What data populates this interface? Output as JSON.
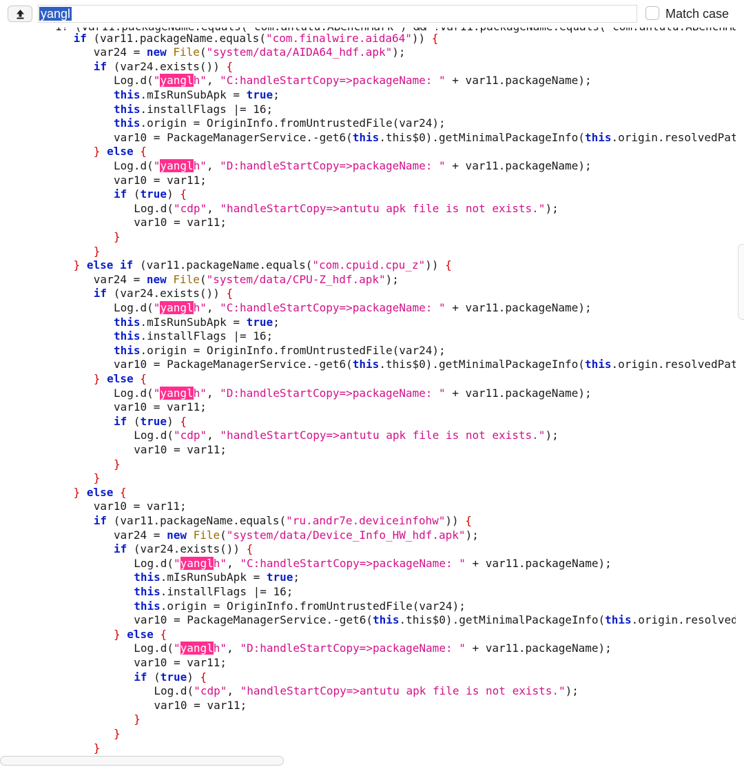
{
  "search": {
    "query": "yangl",
    "match_case_label": "Match case",
    "match_case_checked": false
  },
  "icons": {
    "upload": "upload-arrow-icon"
  },
  "code": {
    "partial_top_line": "1? (var11.packageName.equals(\"com.antutu.ABenchMark\") && !var11.packageName.equals(\"com.antutu.ABenchMa",
    "lines": [
      {
        "i": 3,
        "t": [
          [
            "kw",
            "if"
          ],
          [
            "p",
            " ("
          ],
          [
            "p",
            "var11.packageName.equals("
          ],
          [
            "str",
            "\"com.finalwire.aida64\""
          ],
          [
            "p",
            ")"
          ],
          [
            "p",
            ")"
          ],
          [
            "p",
            " "
          ],
          [
            "br",
            "{"
          ]
        ]
      },
      {
        "i": 4,
        "t": [
          [
            "p",
            "var24 = "
          ],
          [
            "kw",
            "new"
          ],
          [
            "p",
            " "
          ],
          [
            "cls",
            "File"
          ],
          [
            "p",
            "("
          ],
          [
            "str",
            "\"system/data/AIDA64_hdf.apk\""
          ],
          [
            "p",
            ");"
          ]
        ]
      },
      {
        "i": 4,
        "t": [
          [
            "kw",
            "if"
          ],
          [
            "p",
            " ("
          ],
          [
            "p",
            "var24.exists()"
          ],
          [
            "p",
            ")"
          ],
          [
            "p",
            " "
          ],
          [
            "br",
            "{"
          ]
        ]
      },
      {
        "i": 5,
        "t": [
          [
            "p",
            "Log.d("
          ],
          [
            "str",
            "\""
          ],
          [
            "hl",
            "yangl"
          ],
          [
            "str",
            "h\""
          ],
          [
            "p",
            ", "
          ],
          [
            "str",
            "\"C:handleStartCopy=>packageName: \""
          ],
          [
            "p",
            " + var11.packageName);"
          ]
        ]
      },
      {
        "i": 5,
        "t": [
          [
            "kw",
            "this"
          ],
          [
            "p",
            ".mIsRunSubApk = "
          ],
          [
            "kw",
            "true"
          ],
          [
            "p",
            ";"
          ]
        ]
      },
      {
        "i": 5,
        "t": [
          [
            "kw",
            "this"
          ],
          [
            "p",
            ".installFlags |= 16;"
          ]
        ]
      },
      {
        "i": 5,
        "t": [
          [
            "kw",
            "this"
          ],
          [
            "p",
            ".origin = OriginInfo.fromUntrustedFile(var24);"
          ]
        ]
      },
      {
        "i": 5,
        "t": [
          [
            "p",
            "var10 = PackageManagerService.-get6("
          ],
          [
            "kw",
            "this"
          ],
          [
            "p",
            ".this$0).getMinimalPackageInfo("
          ],
          [
            "kw",
            "this"
          ],
          [
            "p",
            ".origin.resolvedPat"
          ]
        ]
      },
      {
        "i": 4,
        "t": [
          [
            "br",
            "}"
          ],
          [
            "p",
            " "
          ],
          [
            "kw",
            "else"
          ],
          [
            "p",
            " "
          ],
          [
            "br",
            "{"
          ]
        ]
      },
      {
        "i": 5,
        "t": [
          [
            "p",
            "Log.d("
          ],
          [
            "str",
            "\""
          ],
          [
            "hl",
            "yangl"
          ],
          [
            "str",
            "h\""
          ],
          [
            "p",
            ", "
          ],
          [
            "str",
            "\"D:handleStartCopy=>packageName: \""
          ],
          [
            "p",
            " + var11.packageName);"
          ]
        ]
      },
      {
        "i": 5,
        "t": [
          [
            "p",
            "var10 = var11;"
          ]
        ]
      },
      {
        "i": 5,
        "t": [
          [
            "kw",
            "if"
          ],
          [
            "p",
            " ("
          ],
          [
            "kw",
            "true"
          ],
          [
            "p",
            ")"
          ],
          [
            "p",
            " "
          ],
          [
            "br",
            "{"
          ]
        ]
      },
      {
        "i": 6,
        "t": [
          [
            "p",
            "Log.d("
          ],
          [
            "str",
            "\"cdp\""
          ],
          [
            "p",
            ", "
          ],
          [
            "str",
            "\"handleStartCopy=>antutu apk file is not exists.\""
          ],
          [
            "p",
            ");"
          ]
        ]
      },
      {
        "i": 6,
        "t": [
          [
            "p",
            "var10 = var11;"
          ]
        ]
      },
      {
        "i": 5,
        "t": [
          [
            "br",
            "}"
          ]
        ]
      },
      {
        "i": 4,
        "t": [
          [
            "br",
            "}"
          ]
        ]
      },
      {
        "i": 3,
        "t": [
          [
            "br",
            "}"
          ],
          [
            "p",
            " "
          ],
          [
            "kw",
            "else"
          ],
          [
            "p",
            " "
          ],
          [
            "kw",
            "if"
          ],
          [
            "p",
            " ("
          ],
          [
            "p",
            "var11.packageName.equals("
          ],
          [
            "str",
            "\"com.cpuid.cpu_z\""
          ],
          [
            "p",
            ")"
          ],
          [
            "p",
            ")"
          ],
          [
            "p",
            " "
          ],
          [
            "br",
            "{"
          ]
        ]
      },
      {
        "i": 4,
        "t": [
          [
            "p",
            "var24 = "
          ],
          [
            "kw",
            "new"
          ],
          [
            "p",
            " "
          ],
          [
            "cls",
            "File"
          ],
          [
            "p",
            "("
          ],
          [
            "str",
            "\"system/data/CPU-Z_hdf.apk\""
          ],
          [
            "p",
            ");"
          ]
        ]
      },
      {
        "i": 4,
        "t": [
          [
            "kw",
            "if"
          ],
          [
            "p",
            " ("
          ],
          [
            "p",
            "var24.exists()"
          ],
          [
            "p",
            ")"
          ],
          [
            "p",
            " "
          ],
          [
            "br",
            "{"
          ]
        ]
      },
      {
        "i": 5,
        "t": [
          [
            "p",
            "Log.d("
          ],
          [
            "str",
            "\""
          ],
          [
            "hl",
            "yangl"
          ],
          [
            "str",
            "h\""
          ],
          [
            "p",
            ", "
          ],
          [
            "str",
            "\"C:handleStartCopy=>packageName: \""
          ],
          [
            "p",
            " + var11.packageName);"
          ]
        ]
      },
      {
        "i": 5,
        "t": [
          [
            "kw",
            "this"
          ],
          [
            "p",
            ".mIsRunSubApk = "
          ],
          [
            "kw",
            "true"
          ],
          [
            "p",
            ";"
          ]
        ]
      },
      {
        "i": 5,
        "t": [
          [
            "kw",
            "this"
          ],
          [
            "p",
            ".installFlags |= 16;"
          ]
        ]
      },
      {
        "i": 5,
        "t": [
          [
            "kw",
            "this"
          ],
          [
            "p",
            ".origin = OriginInfo.fromUntrustedFile(var24);"
          ]
        ]
      },
      {
        "i": 5,
        "t": [
          [
            "p",
            "var10 = PackageManagerService.-get6("
          ],
          [
            "kw",
            "this"
          ],
          [
            "p",
            ".this$0).getMinimalPackageInfo("
          ],
          [
            "kw",
            "this"
          ],
          [
            "p",
            ".origin.resolvedPat"
          ]
        ]
      },
      {
        "i": 4,
        "t": [
          [
            "br",
            "}"
          ],
          [
            "p",
            " "
          ],
          [
            "kw",
            "else"
          ],
          [
            "p",
            " "
          ],
          [
            "br",
            "{"
          ]
        ]
      },
      {
        "i": 5,
        "t": [
          [
            "p",
            "Log.d("
          ],
          [
            "str",
            "\""
          ],
          [
            "hl",
            "yangl"
          ],
          [
            "str",
            "h\""
          ],
          [
            "p",
            ", "
          ],
          [
            "str",
            "\"D:handleStartCopy=>packageName: \""
          ],
          [
            "p",
            " + var11.packageName);"
          ]
        ]
      },
      {
        "i": 5,
        "t": [
          [
            "p",
            "var10 = var11;"
          ]
        ]
      },
      {
        "i": 5,
        "t": [
          [
            "kw",
            "if"
          ],
          [
            "p",
            " ("
          ],
          [
            "kw",
            "true"
          ],
          [
            "p",
            ")"
          ],
          [
            "p",
            " "
          ],
          [
            "br",
            "{"
          ]
        ]
      },
      {
        "i": 6,
        "t": [
          [
            "p",
            "Log.d("
          ],
          [
            "str",
            "\"cdp\""
          ],
          [
            "p",
            ", "
          ],
          [
            "str",
            "\"handleStartCopy=>antutu apk file is not exists.\""
          ],
          [
            "p",
            ");"
          ]
        ]
      },
      {
        "i": 6,
        "t": [
          [
            "p",
            "var10 = var11;"
          ]
        ]
      },
      {
        "i": 5,
        "t": [
          [
            "br",
            "}"
          ]
        ]
      },
      {
        "i": 4,
        "t": [
          [
            "br",
            "}"
          ]
        ]
      },
      {
        "i": 3,
        "t": [
          [
            "br",
            "}"
          ],
          [
            "p",
            " "
          ],
          [
            "kw",
            "else"
          ],
          [
            "p",
            " "
          ],
          [
            "br",
            "{"
          ]
        ]
      },
      {
        "i": 4,
        "t": [
          [
            "p",
            "var10 = var11;"
          ]
        ]
      },
      {
        "i": 4,
        "t": [
          [
            "kw",
            "if"
          ],
          [
            "p",
            " ("
          ],
          [
            "p",
            "var11.packageName.equals("
          ],
          [
            "str",
            "\"ru.andr7e.deviceinfohw\""
          ],
          [
            "p",
            ")"
          ],
          [
            "p",
            ")"
          ],
          [
            "p",
            " "
          ],
          [
            "br",
            "{"
          ]
        ]
      },
      {
        "i": 5,
        "t": [
          [
            "p",
            "var24 = "
          ],
          [
            "kw",
            "new"
          ],
          [
            "p",
            " "
          ],
          [
            "cls",
            "File"
          ],
          [
            "p",
            "("
          ],
          [
            "str",
            "\"system/data/Device_Info_HW_hdf.apk\""
          ],
          [
            "p",
            ");"
          ]
        ]
      },
      {
        "i": 5,
        "t": [
          [
            "kw",
            "if"
          ],
          [
            "p",
            " ("
          ],
          [
            "p",
            "var24.exists()"
          ],
          [
            "p",
            ")"
          ],
          [
            "p",
            " "
          ],
          [
            "br",
            "{"
          ]
        ]
      },
      {
        "i": 6,
        "t": [
          [
            "p",
            "Log.d("
          ],
          [
            "str",
            "\""
          ],
          [
            "hl",
            "yangl"
          ],
          [
            "str",
            "h\""
          ],
          [
            "p",
            ", "
          ],
          [
            "str",
            "\"C:handleStartCopy=>packageName: \""
          ],
          [
            "p",
            " + var11.packageName);"
          ]
        ]
      },
      {
        "i": 6,
        "t": [
          [
            "kw",
            "this"
          ],
          [
            "p",
            ".mIsRunSubApk = "
          ],
          [
            "kw",
            "true"
          ],
          [
            "p",
            ";"
          ]
        ]
      },
      {
        "i": 6,
        "t": [
          [
            "kw",
            "this"
          ],
          [
            "p",
            ".installFlags |= 16;"
          ]
        ]
      },
      {
        "i": 6,
        "t": [
          [
            "kw",
            "this"
          ],
          [
            "p",
            ".origin = OriginInfo.fromUntrustedFile(var24);"
          ]
        ]
      },
      {
        "i": 6,
        "t": [
          [
            "p",
            "var10 = PackageManagerService.-get6("
          ],
          [
            "kw",
            "this"
          ],
          [
            "p",
            ".this$0).getMinimalPackageInfo("
          ],
          [
            "kw",
            "this"
          ],
          [
            "p",
            ".origin.resolved"
          ]
        ]
      },
      {
        "i": 5,
        "t": [
          [
            "br",
            "}"
          ],
          [
            "p",
            " "
          ],
          [
            "kw",
            "else"
          ],
          [
            "p",
            " "
          ],
          [
            "br",
            "{"
          ]
        ]
      },
      {
        "i": 6,
        "t": [
          [
            "p",
            "Log.d("
          ],
          [
            "str",
            "\""
          ],
          [
            "hl",
            "yangl"
          ],
          [
            "str",
            "h\""
          ],
          [
            "p",
            ", "
          ],
          [
            "str",
            "\"D:handleStartCopy=>packageName: \""
          ],
          [
            "p",
            " + var11.packageName);"
          ]
        ]
      },
      {
        "i": 6,
        "t": [
          [
            "p",
            "var10 = var11;"
          ]
        ]
      },
      {
        "i": 6,
        "t": [
          [
            "kw",
            "if"
          ],
          [
            "p",
            " ("
          ],
          [
            "kw",
            "true"
          ],
          [
            "p",
            ")"
          ],
          [
            "p",
            " "
          ],
          [
            "br",
            "{"
          ]
        ]
      },
      {
        "i": 7,
        "t": [
          [
            "p",
            "Log.d("
          ],
          [
            "str",
            "\"cdp\""
          ],
          [
            "p",
            ", "
          ],
          [
            "str",
            "\"handleStartCopy=>antutu apk file is not exists.\""
          ],
          [
            "p",
            ");"
          ]
        ]
      },
      {
        "i": 7,
        "t": [
          [
            "p",
            "var10 = var11;"
          ]
        ]
      },
      {
        "i": 6,
        "t": [
          [
            "br",
            "}"
          ]
        ]
      },
      {
        "i": 5,
        "t": [
          [
            "br",
            "}"
          ]
        ]
      },
      {
        "i": 4,
        "t": [
          [
            "br",
            "}"
          ]
        ]
      }
    ]
  }
}
